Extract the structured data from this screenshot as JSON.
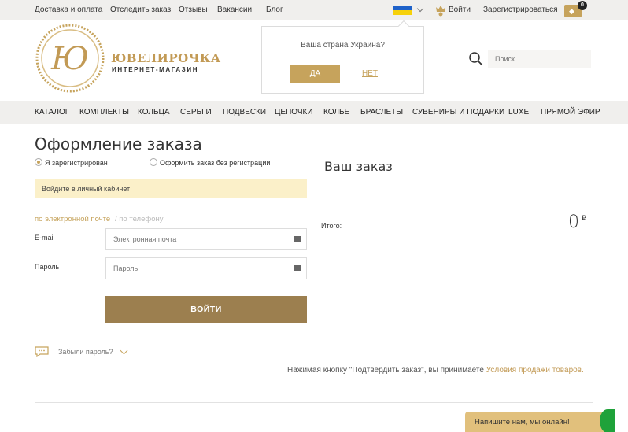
{
  "topbar": {
    "links": [
      "Доставка и оплата",
      "Отследить заказ",
      "Отзывы",
      "Вакансии",
      "Блог"
    ],
    "login": "Войти",
    "register": "Зарегистрироваться",
    "cart_count": "0"
  },
  "header": {
    "brand": "ЮВЕЛИРОЧКА",
    "brand_sub": "ИНТЕРНЕТ-МАГАЗИН",
    "search_placeholder": "Поиск"
  },
  "country_popup": {
    "question": "Ваша страна Украина?",
    "yes": "ДА",
    "no": "НЕТ"
  },
  "nav": {
    "items": [
      "КАТАЛОГ",
      "КОМПЛЕКТЫ",
      "КОЛЬЦА",
      "СЕРЬГИ",
      "ПОДВЕСКИ",
      "ЦЕПОЧКИ",
      "КОЛЬЕ",
      "БРАСЛЕТЫ",
      "СУВЕНИРЫ И ПОДАРКИ",
      "LUXE",
      "ПРЯМОЙ ЭФИР"
    ]
  },
  "checkout": {
    "title": "Оформление заказа",
    "option_registered": "Я зарегистрирован",
    "option_guest": "Оформить заказ без регистрации",
    "notice": "Войдите в личный кабинет",
    "mode_email": "по электронной почте",
    "mode_phone": "/ по телефону",
    "email_label": "E-mail",
    "email_placeholder": "Электронная почта",
    "password_label": "Пароль",
    "password_placeholder": "Пароль",
    "login_button": "ВОЙТИ",
    "forgot": "Забыли пароль?"
  },
  "order": {
    "title": "Ваш заказ",
    "total_label": "Итого:",
    "total_value": "0",
    "currency": "₽"
  },
  "terms": {
    "text": "Нажимая кнопку \"Подтвердить заказ\", вы принимаете ",
    "link": "Условия продажи товаров."
  },
  "chat": {
    "label": "Напишите нам, мы онлайн!"
  },
  "colors": {
    "accent": "#c6a35c",
    "button": "#9c7f4f",
    "notice": "#fbf0c9"
  }
}
